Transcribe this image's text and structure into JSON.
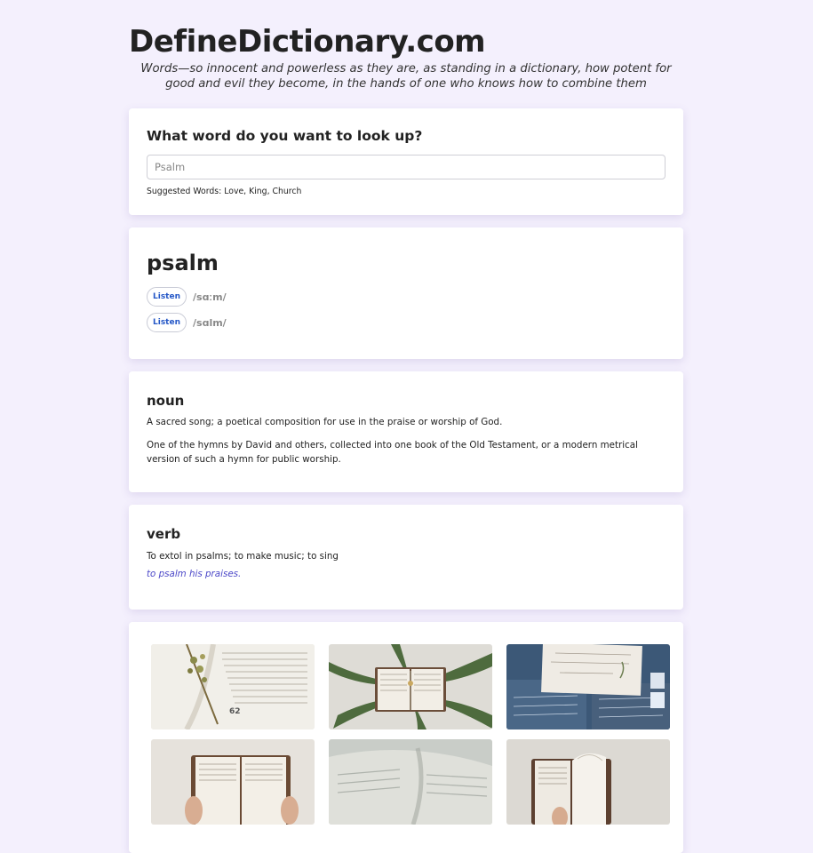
{
  "site": {
    "title": "DefineDictionary.com",
    "tagline": "Words—so innocent and powerless as they are, as standing in a dictionary, how potent for good and evil they become, in the hands of one who knows how to combine them"
  },
  "search": {
    "heading": "What word do you want to look up?",
    "placeholder": "Psalm",
    "value": "",
    "suggested_label": "Suggested Words:",
    "suggestions": [
      "Love",
      "King",
      "Church"
    ]
  },
  "entry": {
    "word": "psalm",
    "pronunciations": [
      {
        "button": "Listen",
        "text": "/sɑːm/"
      },
      {
        "button": "Listen",
        "text": "/sɑlm/"
      }
    ]
  },
  "meanings": [
    {
      "part_of_speech": "noun",
      "definitions": [
        "A sacred song; a poetical composition for use in the praise or worship of God.",
        "One of the hymns by David and others, collected into one book of the Old Testament, or a modern metrical version of such a hymn for public worship."
      ]
    },
    {
      "part_of_speech": "verb",
      "definitions": [
        "To extol in psalms; to make music; to sing"
      ],
      "example": "to psalm his praises."
    }
  ],
  "gallery": {
    "images": [
      {
        "name": "open-book-with-dried-flower-photo"
      },
      {
        "name": "bible-on-fern-leaves-photo"
      },
      {
        "name": "handwritten-letters-blue-paper-photo"
      },
      {
        "name": "hands-holding-open-bible-photo"
      },
      {
        "name": "blurred-open-book-pages-photo"
      },
      {
        "name": "hand-flipping-bible-pages-photo"
      }
    ]
  }
}
